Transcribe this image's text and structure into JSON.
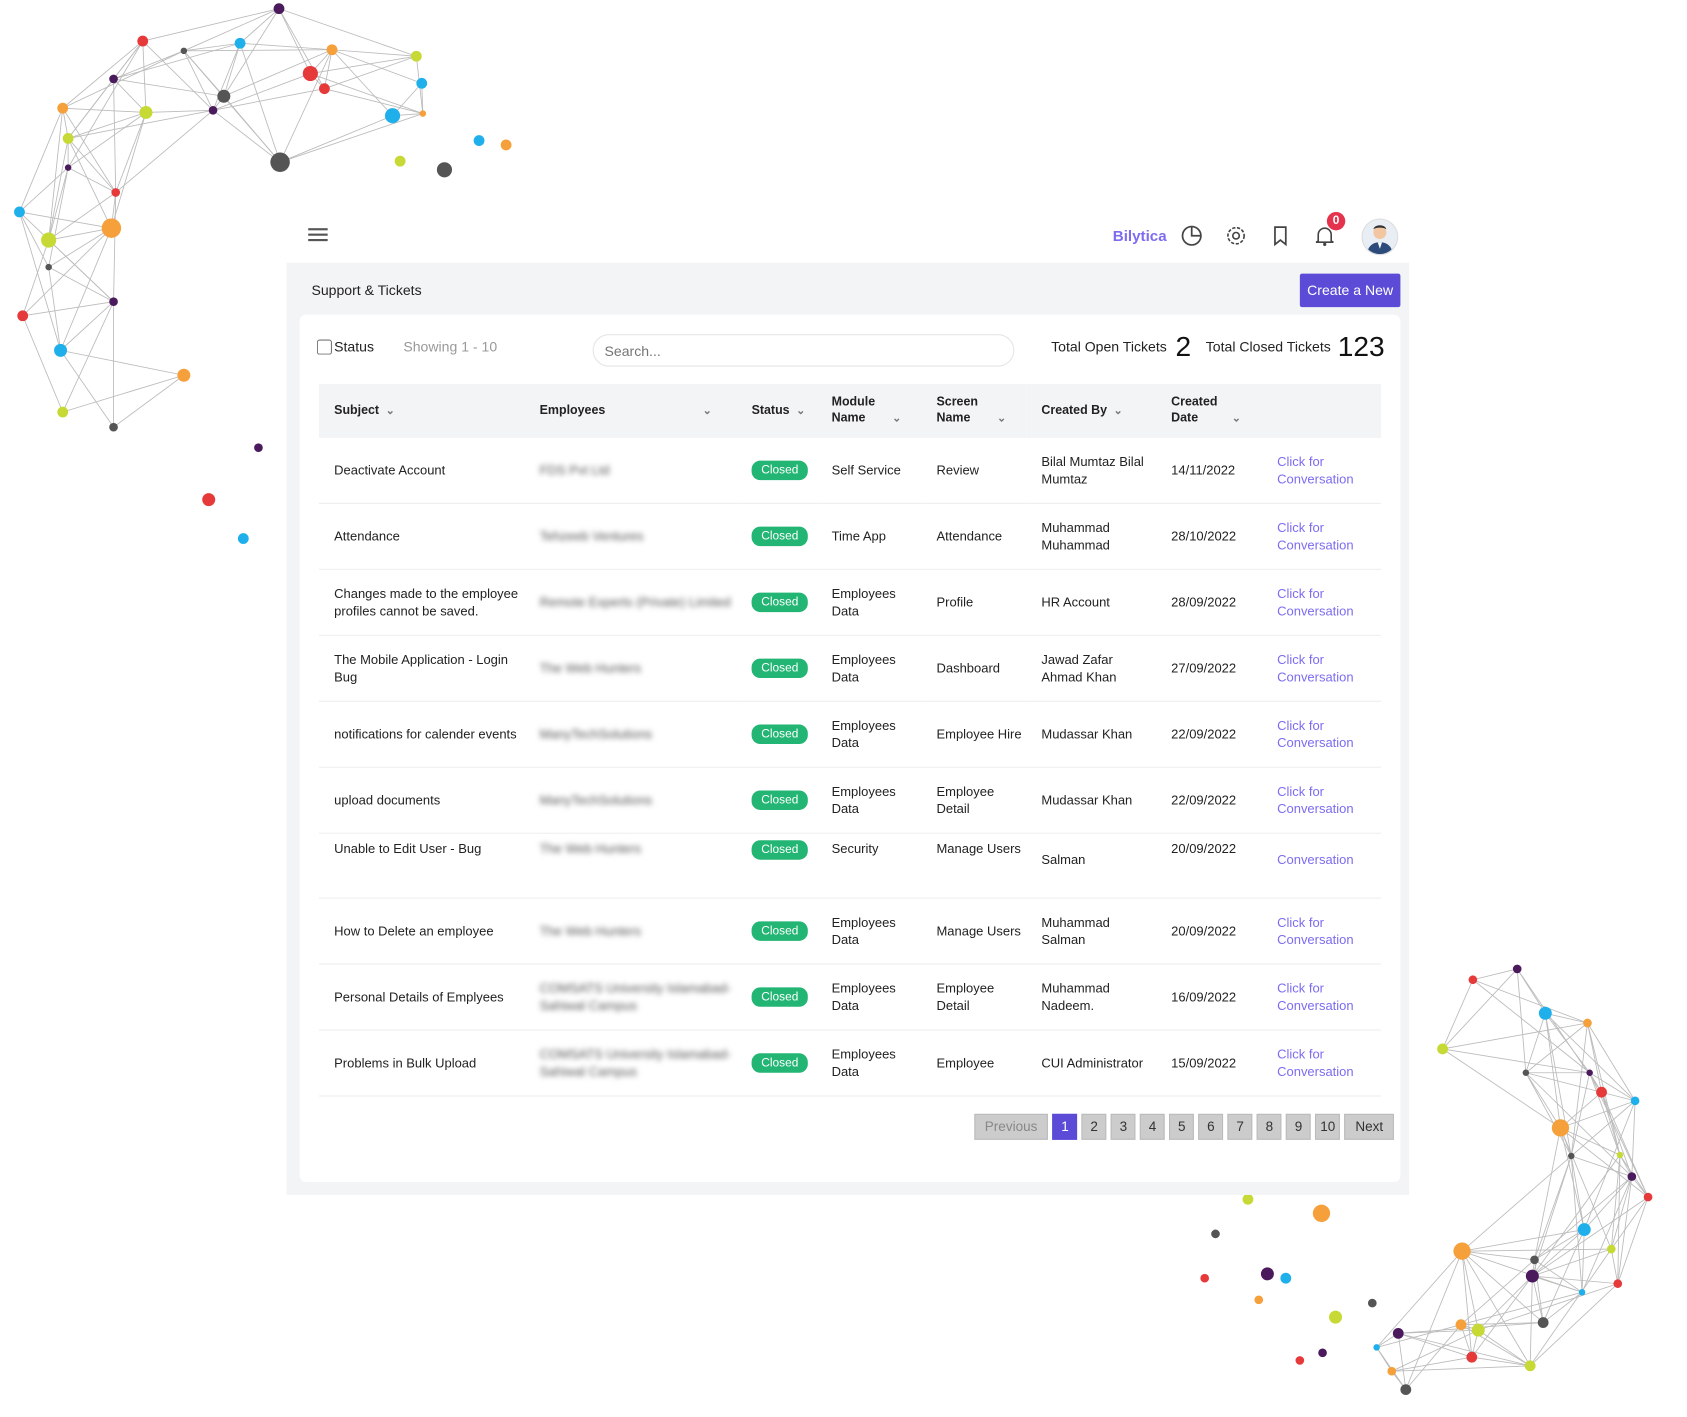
{
  "header": {
    "brand": "Bilytica",
    "notification_count": "0",
    "icons": [
      "menu-icon",
      "pie-chart-icon",
      "gear-icon",
      "bookmark-icon",
      "bell-icon",
      "avatar"
    ]
  },
  "page": {
    "title": "Support & Tickets",
    "create_label": "Create a New"
  },
  "toolbar": {
    "status_label": "Status",
    "showing": "Showing 1 - 10",
    "search_placeholder": "Search...",
    "open_label": "Total Open Tickets",
    "open_count": "2",
    "closed_label": "Total Closed Tickets",
    "closed_count": "123"
  },
  "table": {
    "headers": [
      "Subject",
      "Employees",
      "Status",
      "Module Name",
      "Screen Name",
      "Created By",
      "Created Date",
      ""
    ],
    "rows": [
      {
        "subject": "Deactivate Account",
        "employee": "FDS Pvt Ltd",
        "status": "Closed",
        "module": "Self Service",
        "screen": "Review",
        "created_by": "Bilal Mumtaz Bilal Mumtaz",
        "date": "14/11/2022",
        "link": "Click for Conversation"
      },
      {
        "subject": "Attendance",
        "employee": "Tehzeeb Ventures",
        "status": "Closed",
        "module": "Time App",
        "screen": "Attendance",
        "created_by": "Muhammad Muhammad",
        "date": "28/10/2022",
        "link": "Click for Conversation"
      },
      {
        "subject": "Changes made to the employee profiles cannot be saved.",
        "employee": "Remote Experts (Private) Limited",
        "status": "Closed",
        "module": "Employees Data",
        "screen": "Profile",
        "created_by": "HR Account",
        "date": "28/09/2022",
        "link": "Click for Conversation"
      },
      {
        "subject": "The Mobile Application - Login Bug",
        "employee": "The Web Hunters",
        "status": "Closed",
        "module": "Employees Data",
        "screen": "Dashboard",
        "created_by": "Jawad Zafar Ahmad Khan",
        "date": "27/09/2022",
        "link": "Click for Conversation"
      },
      {
        "subject": "notifications for calender events",
        "employee": "ManyTechSolutions",
        "status": "Closed",
        "module": "Employees Data",
        "screen": "Employee Hire",
        "created_by": "Mudassar Khan",
        "date": "22/09/2022",
        "link": "Click for Conversation"
      },
      {
        "subject": "upload documents",
        "employee": "ManyTechSolutions",
        "status": "Closed",
        "module": "Employees Data",
        "screen": "Employee Detail",
        "created_by": "Mudassar Khan",
        "date": "22/09/2022",
        "link": "Click for Conversation"
      },
      {
        "subject": "Unable to Edit User - Bug",
        "employee": "The Web Hunters",
        "status": "Closed",
        "module": "Security",
        "screen": "Manage Users",
        "created_by": "Salman",
        "date": "20/09/2022",
        "link": "Conversation"
      },
      {
        "subject": "How to Delete an employee",
        "employee": "The Web Hunters",
        "status": "Closed",
        "module": "Employees Data",
        "screen": "Manage Users",
        "created_by": "Muhammad Salman",
        "date": "20/09/2022",
        "link": "Click for Conversation"
      },
      {
        "subject": "Personal Details of Emplyees",
        "employee": "COMSATS University Islamabad-Sahiwal Campus",
        "status": "Closed",
        "module": "Employees Data",
        "screen": "Employee Detail",
        "created_by": "Muhammad Nadeem.",
        "date": "16/09/2022",
        "link": "Click for Conversation"
      },
      {
        "subject": "Problems in Bulk Upload",
        "employee": "COMSATS University Islamabad-Sahiwal Campus",
        "status": "Closed",
        "module": "Employees Data",
        "screen": "Employee",
        "created_by": "CUI Administrator",
        "date": "15/09/2022",
        "link": "Click for Conversation"
      }
    ]
  },
  "pagination": {
    "previous": "Previous",
    "pages": [
      "1",
      "2",
      "3",
      "4",
      "5",
      "6",
      "7",
      "8",
      "9",
      "10"
    ],
    "active": "1",
    "next": "Next"
  },
  "colors": {
    "accent": "#5b4bd6",
    "brand": "#7b6cf0",
    "closed": "#22b573",
    "badge": "#e5334d"
  }
}
